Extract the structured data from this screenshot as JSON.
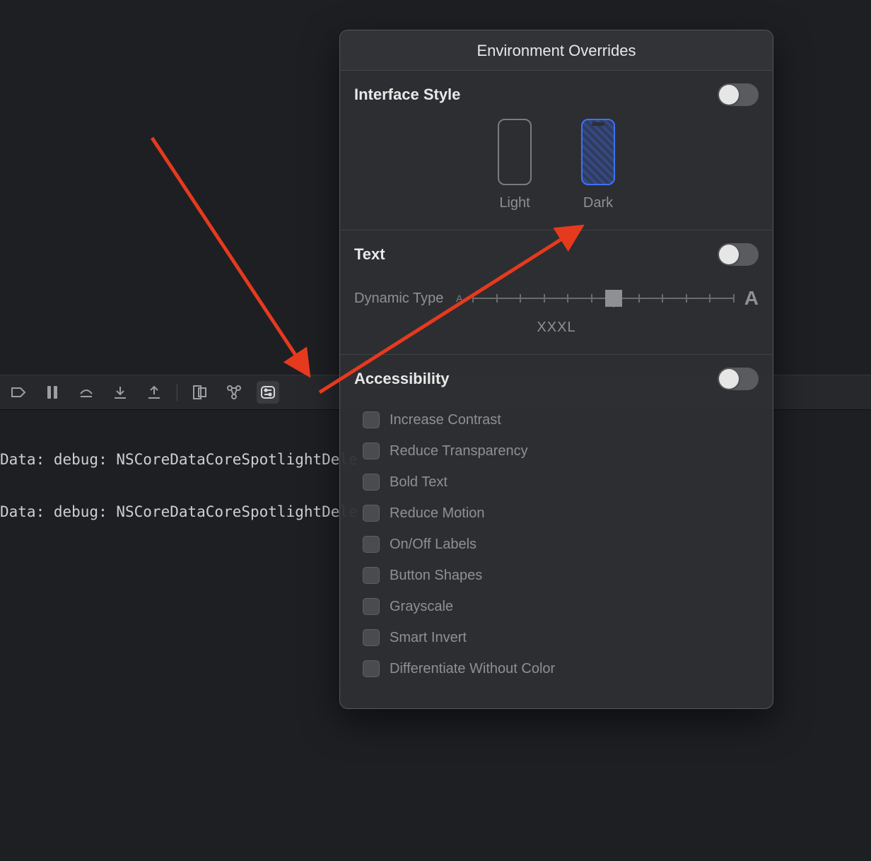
{
  "popover": {
    "title": "Environment Overrides",
    "sections": {
      "interfaceStyle": {
        "title": "Interface Style",
        "options": {
          "light": "Light",
          "dark": "Dark"
        }
      },
      "text": {
        "title": "Text",
        "dynamicTypeLabel": "Dynamic Type",
        "sliderMinGlyph": "A",
        "sliderMaxGlyph": "A",
        "sliderValueLabel": "XXXL"
      },
      "accessibility": {
        "title": "Accessibility",
        "items": [
          "Increase Contrast",
          "Reduce Transparency",
          "Bold Text",
          "Reduce Motion",
          "On/Off Labels",
          "Button Shapes",
          "Grayscale",
          "Smart Invert",
          "Differentiate Without Color"
        ]
      }
    }
  },
  "console": {
    "lines": [
      "Data: debug: NSCoreDataCoreSpotlightDele",
      "Data: debug: NSCoreDataCoreSpotlightDele"
    ]
  }
}
